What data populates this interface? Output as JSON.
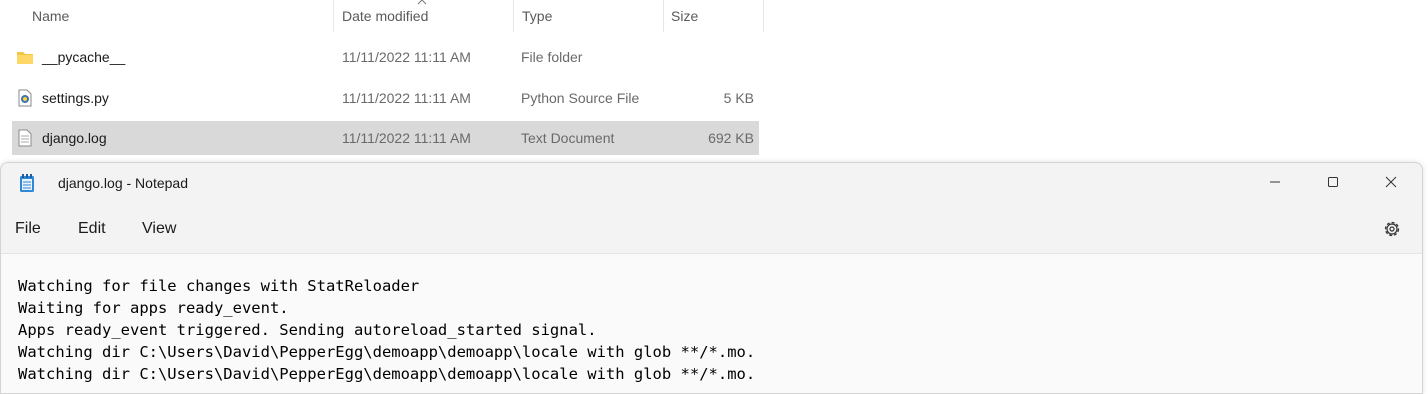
{
  "explorer": {
    "columns": {
      "name": "Name",
      "date_modified": "Date modified",
      "type": "Type",
      "size": "Size"
    },
    "sort_indicator": "chevron-up-icon",
    "files": [
      {
        "name": "__pycache__",
        "date": "11/11/2022 11:11 AM",
        "type": "File folder",
        "size": "",
        "icon": "folder-icon"
      },
      {
        "name": "settings.py",
        "date": "11/11/2022 11:11 AM",
        "type": "Python Source File",
        "size": "5 KB",
        "icon": "python-file-icon"
      },
      {
        "name": "django.log",
        "date": "11/11/2022 11:11 AM",
        "type": "Text Document",
        "size": "692 KB",
        "icon": "text-file-icon",
        "selected": true
      }
    ]
  },
  "notepad": {
    "title": "django.log - Notepad",
    "menu": {
      "file": "File",
      "edit": "Edit",
      "view": "View"
    },
    "lines": [
      "Watching for file changes with StatReloader",
      "Waiting for apps ready_event.",
      "Apps ready_event triggered. Sending autoreload_started signal.",
      "Watching dir C:\\Users\\David\\PepperEgg\\demoapp\\demoapp\\locale with glob **/*.mo.",
      "Watching dir C:\\Users\\David\\PepperEgg\\demoapp\\demoapp\\locale with glob **/*.mo."
    ]
  },
  "colors": {
    "selected_row": "#d9d9d9",
    "folder": "#f4c542",
    "notepad_icon": "#2f87d8"
  }
}
